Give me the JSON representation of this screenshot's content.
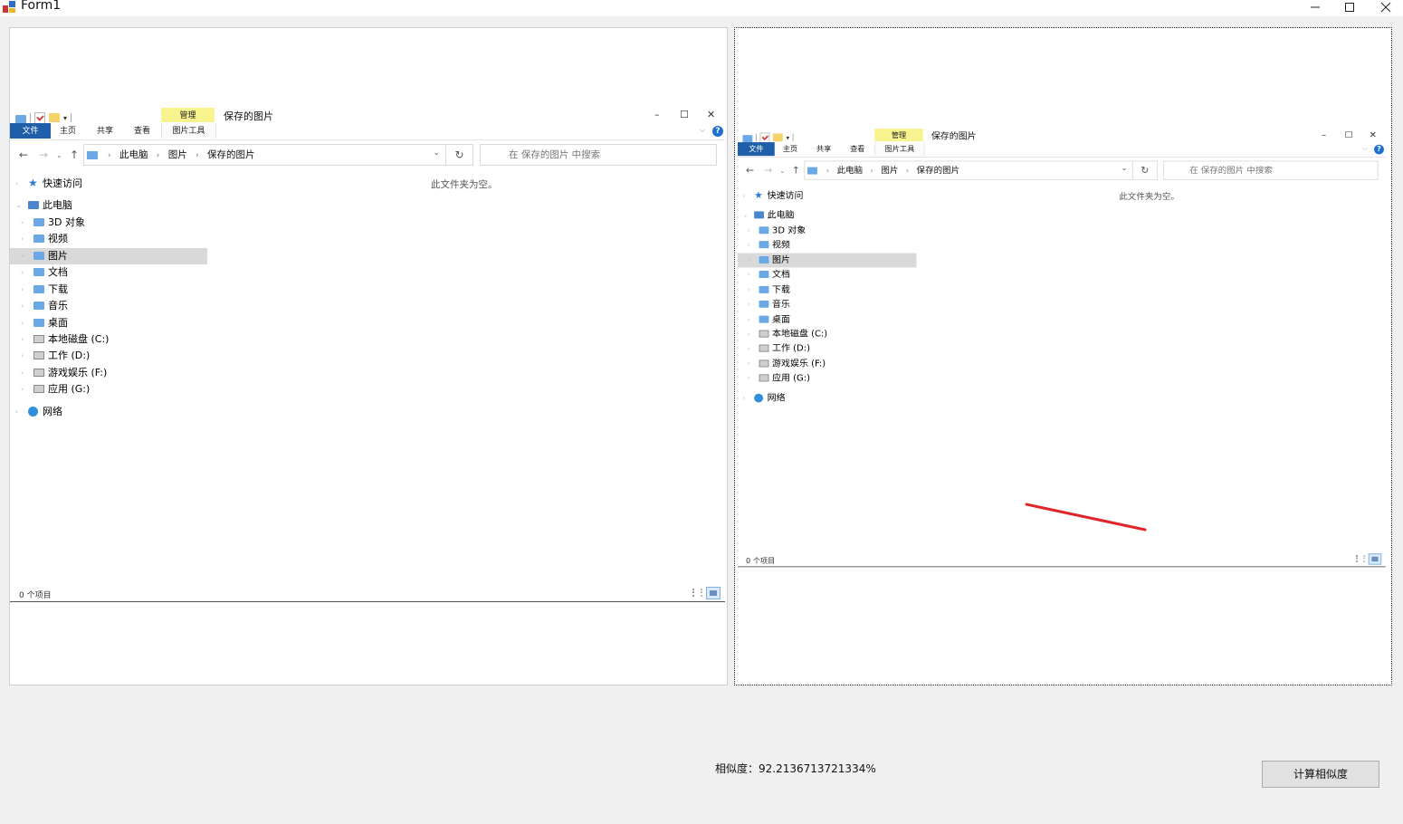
{
  "window": {
    "title": "Form1",
    "min_label": "–",
    "max_label": "☐",
    "close_label": "✕"
  },
  "explorer": {
    "context_tab": "管理",
    "window_title": "保存的图片",
    "tabs": {
      "file": "文件",
      "home": "主页",
      "share": "共享",
      "view": "查看",
      "tools": "图片工具"
    },
    "controls": {
      "min": "–",
      "max": "☐",
      "close": "✕"
    },
    "help": "?",
    "ribbon_chevron": "⌵",
    "nav": {
      "back": "←",
      "forward": "→",
      "recent": "⌄",
      "up": "↑"
    },
    "breadcrumbs": [
      "此电脑",
      "图片",
      "保存的图片"
    ],
    "crumb_sep": "›",
    "addr_dropdown": "⌄",
    "refresh": "↻",
    "search_placeholder": "在 保存的图片 中搜索",
    "tree": [
      {
        "label": "快速访问",
        "icon": "star-icon",
        "level": 0
      },
      {
        "label": "此电脑",
        "icon": "pc-icon",
        "level": 0,
        "expanded": true
      },
      {
        "label": "3D 对象",
        "icon": "folder-icon",
        "level": 1
      },
      {
        "label": "视频",
        "icon": "folder-icon",
        "level": 1
      },
      {
        "label": "图片",
        "icon": "folder-icon",
        "level": 1,
        "selected": true
      },
      {
        "label": "文档",
        "icon": "folder-icon",
        "level": 1
      },
      {
        "label": "下载",
        "icon": "folder-icon",
        "level": 1
      },
      {
        "label": "音乐",
        "icon": "folder-icon",
        "level": 1
      },
      {
        "label": "桌面",
        "icon": "folder-icon",
        "level": 1
      },
      {
        "label": "本地磁盘 (C:)",
        "icon": "drive-icon",
        "level": 1
      },
      {
        "label": "工作 (D:)",
        "icon": "drive-icon",
        "level": 1
      },
      {
        "label": "游戏娱乐 (F:)",
        "icon": "drive-icon",
        "level": 1
      },
      {
        "label": "应用 (G:)",
        "icon": "drive-icon",
        "level": 1
      },
      {
        "label": "网络",
        "icon": "network-icon",
        "level": 0
      }
    ],
    "empty_message": "此文件夹为空。",
    "status": "0 个项目"
  },
  "colors": {
    "accent": "#1f5ea8",
    "manage_tag": "#f7f38e",
    "selected_row": "#d9d9d9",
    "red_mark": "#e0262b"
  },
  "similarity_text": "相似度：92.2136713721334%",
  "calc_button_label": "计算相似度"
}
